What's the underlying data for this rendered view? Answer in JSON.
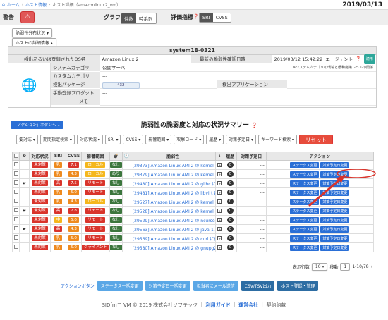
{
  "breadcrumb": [
    "ホーム",
    "ホスト情報",
    "ホスト詳細（amazonlinux2_vm）"
  ],
  "date": "2019/03/13",
  "alert": {
    "label": "警告",
    "icon": "warning-icon"
  },
  "graph": {
    "label": "グラフ",
    "opt1": "件数",
    "opt2": "時系列"
  },
  "metric": {
    "label": "評価指標",
    "opt1": "SRI",
    "opt2": "CVSS"
  },
  "dist_btn": "脆弱性分布状況",
  "detail_btn": "ホストの詳細情報",
  "host": {
    "title": "system18-0321",
    "os_label": "検出あるいは登録されたOS名",
    "os_value": "Amazon Linux 2",
    "latest_label": "最新の脆弱性確認日時",
    "latest_value": "2019/03/12 15:42:22",
    "agent": "エージェント",
    "agent_btn": "適用",
    "sys_label": "システムカテゴリ",
    "sys_value": "公開サーバ",
    "sys_note": "※システムカテゴリの環境と緩和施策レベルの関係",
    "custom_label": "カスタムカテゴリ",
    "custom_value": "---",
    "pkg_label": "検出パッケージ",
    "pkg_value": "432",
    "app_label": "検出アプリケーション",
    "app_value": "---",
    "manual_label": "手動登録プロダクト",
    "manual_value": "---",
    "memo_label": "メモ",
    "memo_value": ""
  },
  "action_btn": "「アクション」ボタンへ",
  "summary_title": "脆弱性の脆弱度と対応の状況サマリー",
  "filters": [
    "要対応",
    "期間指定検索",
    "対応状況",
    "SRI",
    "CVSS",
    "影響範囲",
    "攻撃コード",
    "履歴",
    "対策予定日",
    "キーワード検索"
  ],
  "reset": "リセット",
  "columns": [
    "",
    "",
    "対応状況",
    "SRI",
    "CVSS",
    "影響範囲",
    "",
    "",
    "脆弱性",
    "",
    "履歴",
    "対策予定日",
    "アクション"
  ],
  "rows": [
    {
      "status": "未対策",
      "sri": "乳",
      "sric": "org",
      "cvss": "7.1",
      "cvc": "red",
      "scope": "ローカル",
      "scc": "yel",
      "code": "なし",
      "vuln": "[29373] Amazon Linux AMI 2 の kernel に...",
      "hist": "0",
      "plan": "---",
      "hand": ""
    },
    {
      "status": "未対策",
      "sri": "乳",
      "sric": "org",
      "cvss": "4.3",
      "cvc": "org",
      "scope": "ローカル",
      "scc": "yel",
      "code": "あり",
      "vuln": "[29379] Amazon Linux AMI 2 の kernel に...",
      "hist": "0",
      "plan": "---",
      "hand": ""
    },
    {
      "status": "未対策",
      "sri": "高",
      "sric": "red",
      "cvss": "7.5",
      "cvc": "red",
      "scope": "リモート",
      "scc": "red",
      "code": "なし",
      "vuln": "[29480] Amazon Linux AMI 2 の glibc に関...",
      "hist": "0",
      "plan": "---",
      "hand": "☛"
    },
    {
      "status": "未対策",
      "sri": "乳",
      "sric": "org",
      "cvss": "5.0",
      "cvc": "org",
      "scope": "リモート",
      "scc": "red",
      "code": "なし",
      "vuln": "[29481] Amazon Linux AMI 2 の libvirt に...",
      "hist": "0",
      "plan": "---",
      "hand": ""
    },
    {
      "status": "未対策",
      "sri": "乳",
      "sric": "org",
      "cvss": "4.3",
      "cvc": "org",
      "scope": "ローカル",
      "scc": "yel",
      "code": "なし",
      "vuln": "[29527] Amazon Linux AMI 2 の kernel に X...",
      "hist": "0",
      "plan": "---",
      "hand": ""
    },
    {
      "status": "未対策",
      "sri": "高",
      "sric": "red",
      "cvss": "7.8",
      "cvc": "red",
      "scope": "リモート",
      "scc": "red",
      "code": "なし",
      "vuln": "[29528] Amazon Linux AMI 2 の kernel に T...",
      "hist": "0",
      "plan": "---",
      "hand": "☛"
    },
    {
      "status": "未対策",
      "sri": "中",
      "sric": "yel",
      "cvss": "5.0",
      "cvc": "org",
      "scope": "リモート",
      "scc": "red",
      "code": "なし",
      "vuln": "[29529] Amazon Linux AMI 2 の ncurses に...",
      "hist": "0",
      "plan": "---",
      "hand": ""
    },
    {
      "status": "未対策",
      "sri": "高",
      "sric": "red",
      "cvss": "4.3",
      "cvc": "org",
      "scope": "リモート",
      "scc": "red",
      "code": "なし",
      "vuln": "[29563] Amazon Linux AMI 2 の java-1.8.0-...",
      "hist": "0",
      "plan": "---",
      "hand": "☛"
    },
    {
      "status": "未対策",
      "sri": "乳",
      "sric": "org",
      "cvss": "5.0",
      "cvc": "org",
      "scope": "リモート",
      "scc": "red",
      "code": "なし",
      "vuln": "[29569] Amazon Linux AMI 2 の curl に任...",
      "hist": "0",
      "plan": "---",
      "hand": ""
    },
    {
      "status": "未対策",
      "sri": "乳",
      "sric": "org",
      "cvss": "5.0",
      "cvc": "org",
      "scope": "クライアント",
      "scc": "red",
      "code": "なし",
      "vuln": "[29580] Amazon Linux AMI 2 の gnupg2 に...",
      "hist": "0",
      "plan": "---",
      "hand": ""
    }
  ],
  "row_btn_status": "ステータス変更",
  "row_btn_plan": "対策予定日変更",
  "pager": {
    "label": "表示行数",
    "value": "10",
    "move": "移動",
    "page": "1",
    "range": "1-10/78"
  },
  "bottom": {
    "label": "アクションボタン",
    "b1": "ステータス一括変更",
    "b2": "対策予定日一括変更",
    "b3": "担当者にメール送信",
    "b4": "CSV/TSV出力",
    "b5": "ホスト登録・管理"
  },
  "footer": {
    "copy": "SIDfm™ VM © 2019 株式会社ソフテック",
    "guide": "利用ガイド",
    "company": "運営会社",
    "terms": "契約約款"
  },
  "colors": {
    "accent": "#2a6fd6",
    "danger": "#d9342b"
  }
}
